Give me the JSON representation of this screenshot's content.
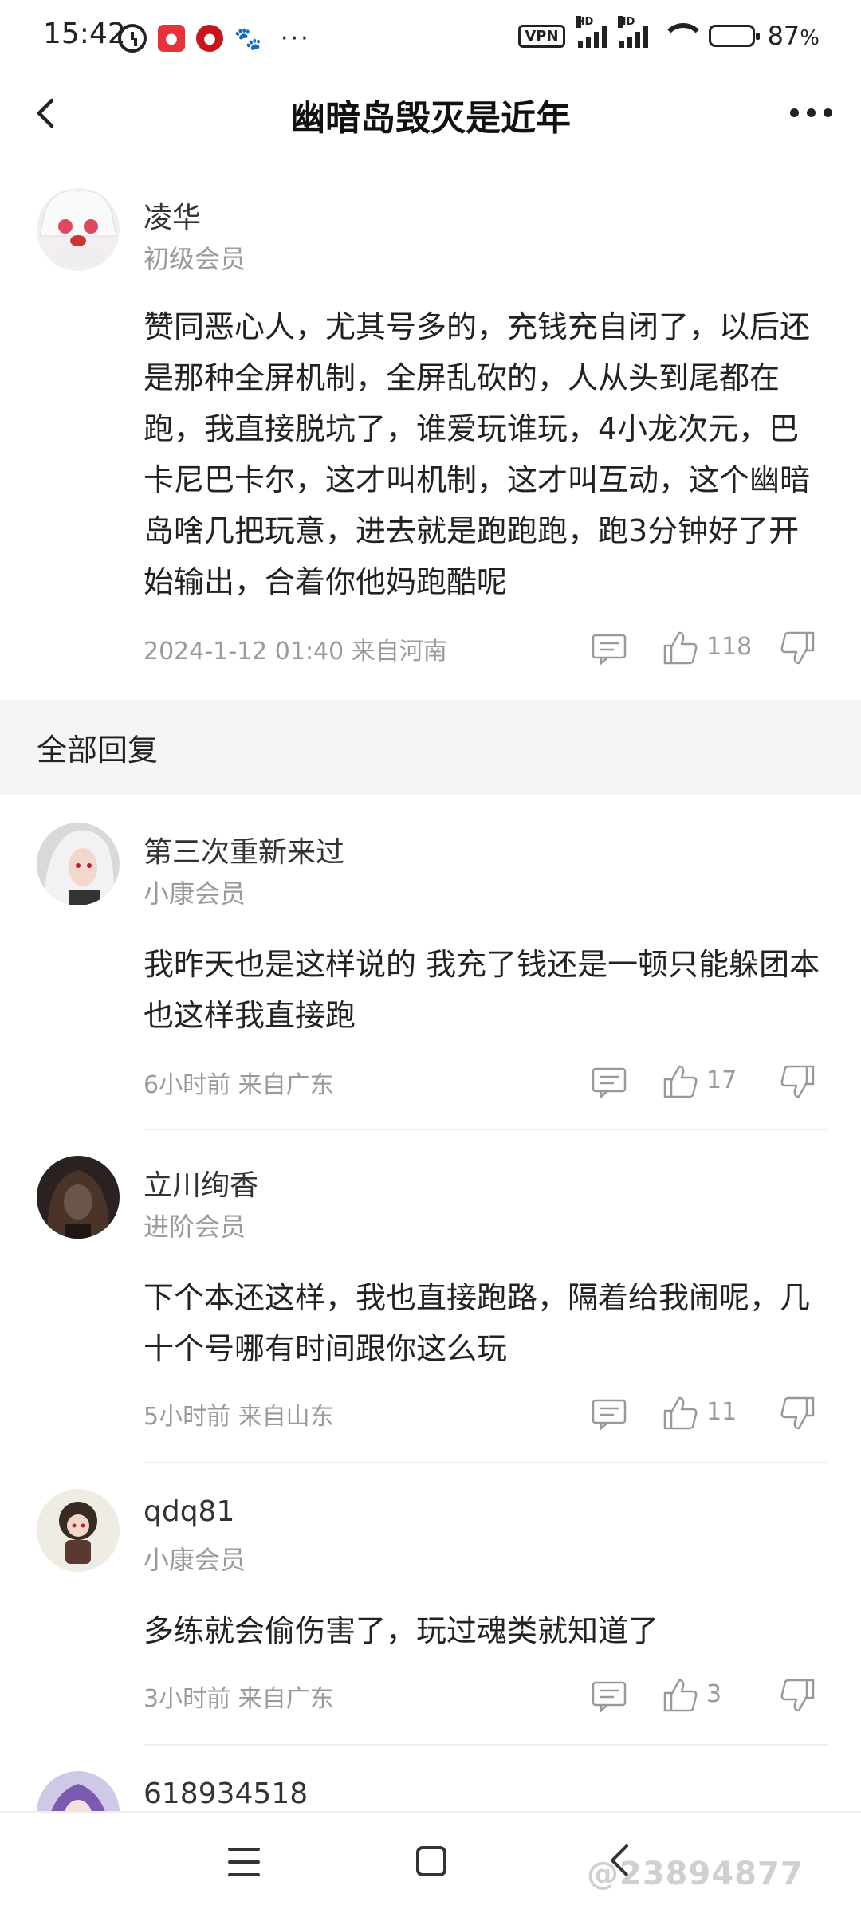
{
  "status_bar": {
    "time": "15:42",
    "dots": "···",
    "vpn": "VPN",
    "hd1": "HD",
    "hd2": "HD",
    "battery": "87",
    "battery_suffix": "%"
  },
  "header": {
    "title": "幽暗岛毁灭是近年"
  },
  "main_post": {
    "username": "凌华",
    "level": "初级会员",
    "text": "赞同恶心人，尤其号多的，充钱充自闭了，以后还是那种全屏机制，全屏乱砍的，人从头到尾都在跑，我直接脱坑了，谁爱玩谁玩，4小龙次元，巴卡尼巴卡尔，这才叫机制，这才叫互动，这个幽暗岛啥几把玩意，进去就是跑跑跑，跑3分钟好了开始输出，合着你他妈跑酷呢",
    "meta": "2024-1-12 01:40  来自河南",
    "likes": "118"
  },
  "section": {
    "title": "全部回复"
  },
  "replies": [
    {
      "username": "第三次重新来过",
      "level": "小康会员",
      "text": "我昨天也是这样说的 我充了钱还是一顿只能躲团本也这样我直接跑",
      "meta": "6小时前 来自广东",
      "likes": "17"
    },
    {
      "username": "立川绚香",
      "level": "进阶会员",
      "text": "下个本还这样，我也直接跑路，隔着给我闹呢，几十个号哪有时间跟你这么玩",
      "meta": "5小时前 来自山东",
      "likes": "11"
    },
    {
      "username": "qdq81",
      "level": "小康会员",
      "text": "多练就会偷伤害了，玩过魂类就知道了",
      "meta": "3小时前 来自广东",
      "likes": "3"
    },
    {
      "username": "618934518"
    }
  ],
  "watermark": "@23894877",
  "icons": {
    "back": "chevron-left-icon",
    "more": "more-dots-icon",
    "comment": "comment-icon",
    "like": "thumbs-up-icon",
    "dislike": "thumbs-down-icon"
  }
}
